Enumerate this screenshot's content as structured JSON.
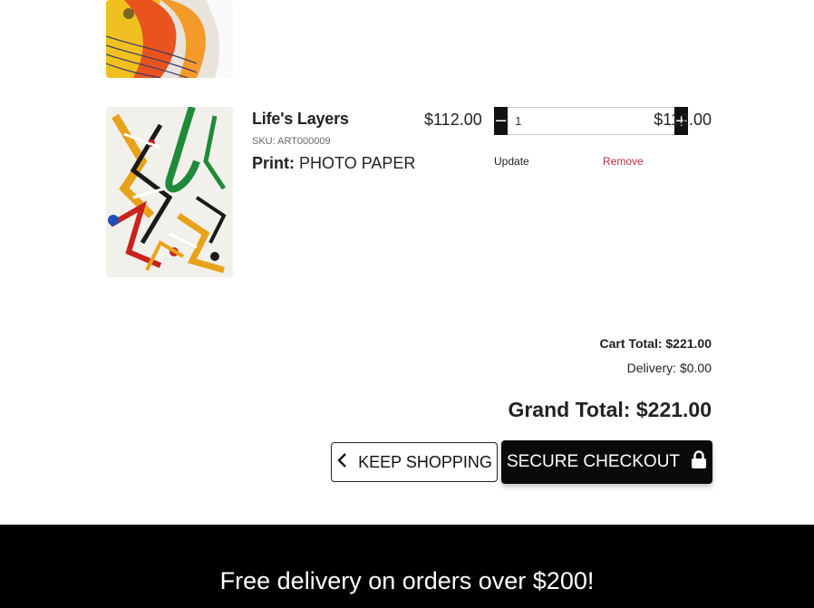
{
  "cart": {
    "item": {
      "title": "Life's Layers",
      "sku": "SKU: ART000009",
      "print_label": "Print:",
      "print_value": "PHOTO PAPER",
      "unit_price": "$112.00",
      "quantity": "1",
      "line_total": "$112.00",
      "update_label": "Update",
      "remove_label": "Remove",
      "decrement_symbol": "−",
      "increment_symbol": "+"
    },
    "summary": {
      "cart_total": "Cart Total: $221.00",
      "delivery": "Delivery: $0.00",
      "grand_total": "Grand Total: $221.00"
    },
    "actions": {
      "keep_shopping": "KEEP SHOPPING",
      "secure_checkout": "SECURE CHECKOUT"
    }
  },
  "footer": {
    "promo": "Free delivery on orders over $200!"
  },
  "icons": {
    "back": "chevron-left-icon",
    "checkout": "lock-icon"
  },
  "colors": {
    "button_dark": "#0a0a0a",
    "remove_link": "#c0283c",
    "footer_bg": "#000000"
  }
}
